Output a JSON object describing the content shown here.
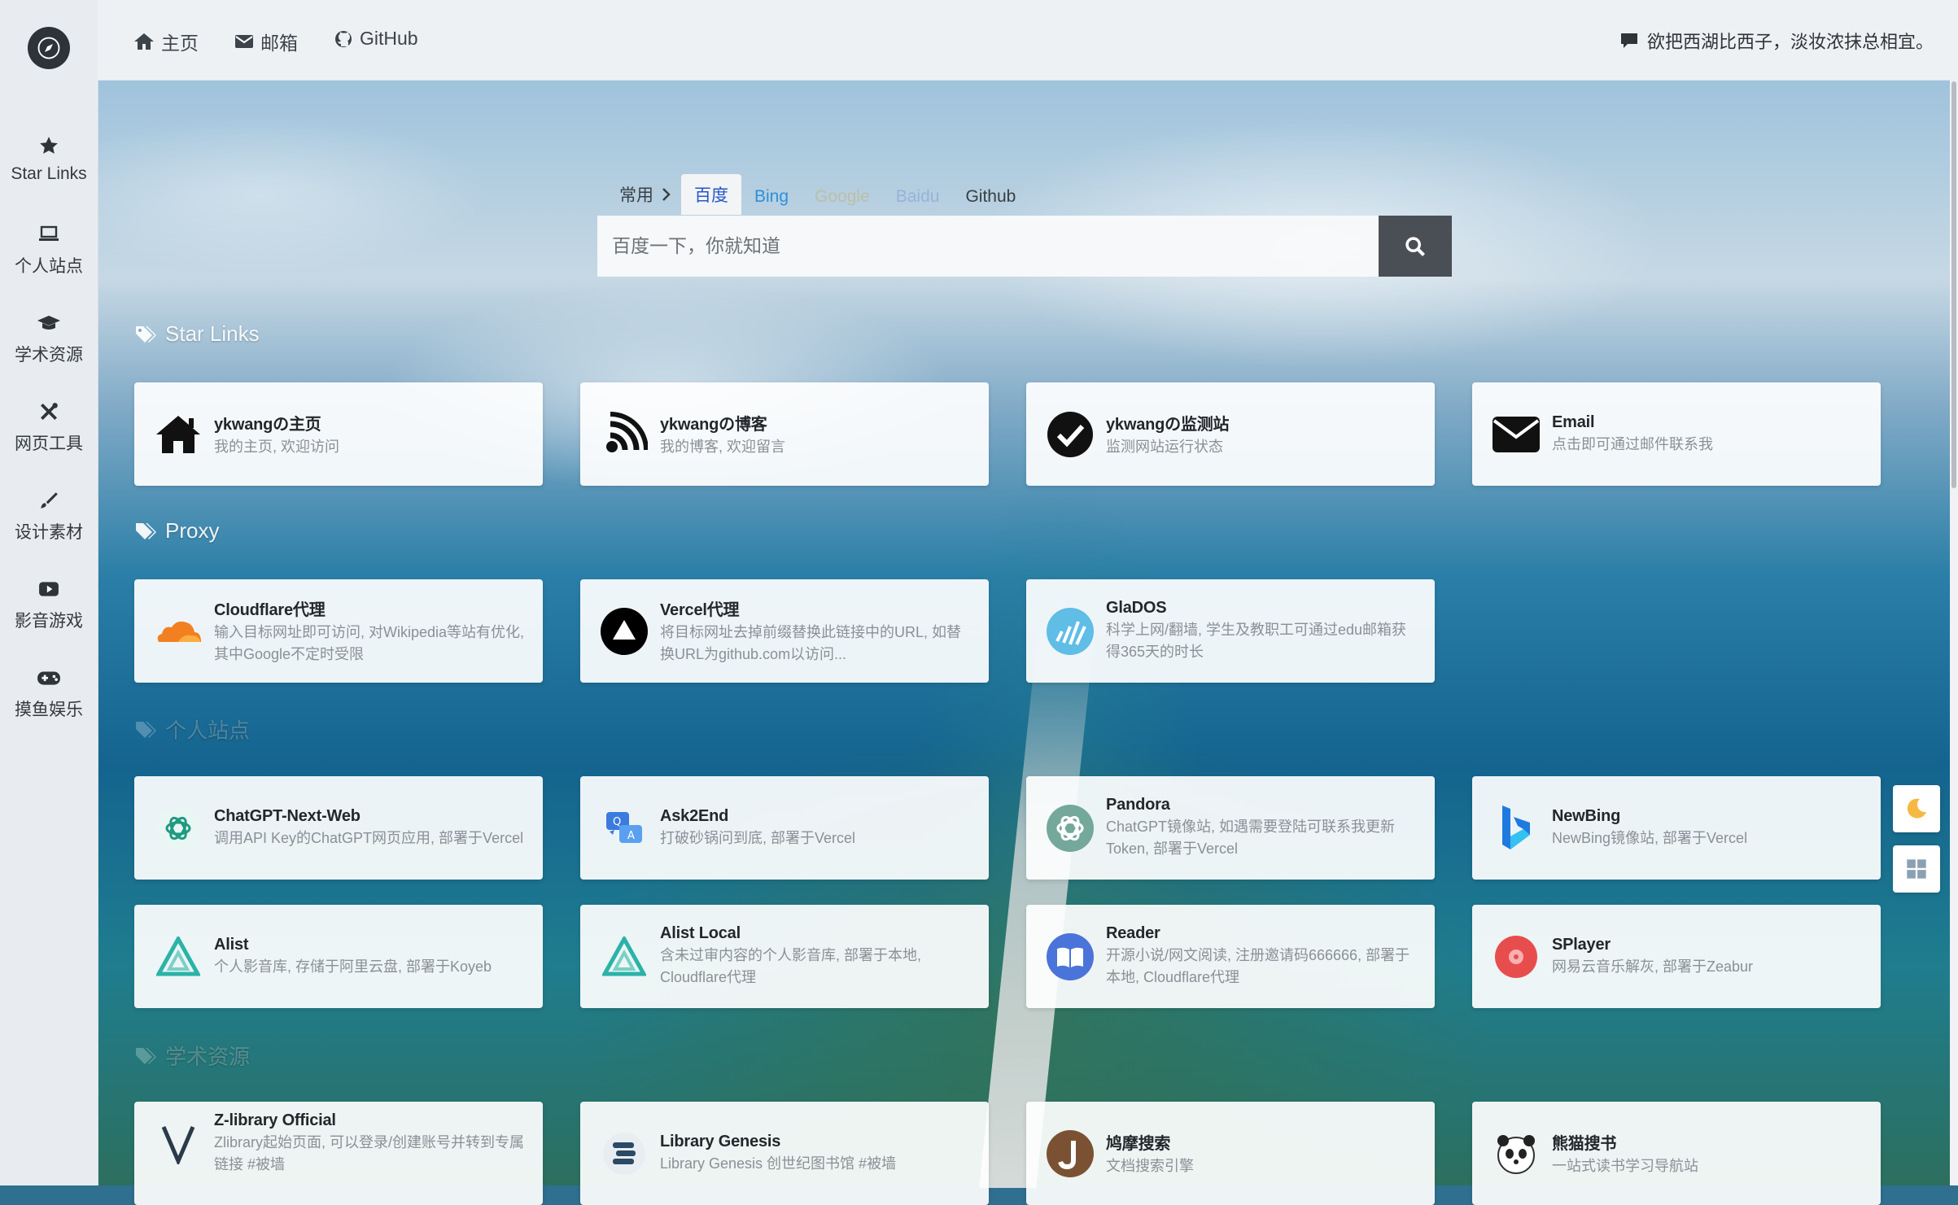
{
  "topbar": {
    "links": [
      {
        "label": "主页",
        "icon": "home-icon"
      },
      {
        "label": "邮箱",
        "icon": "mail-icon"
      },
      {
        "label": "GitHub",
        "icon": "github-icon"
      }
    ],
    "quote": "欲把西湖比西子，淡妆浓抹总相宜。"
  },
  "sidebar": {
    "items": [
      {
        "label": "Star Links",
        "icon": "star-icon"
      },
      {
        "label": "个人站点",
        "icon": "laptop-icon"
      },
      {
        "label": "学术资源",
        "icon": "graduation-cap-icon"
      },
      {
        "label": "网页工具",
        "icon": "tools-icon"
      },
      {
        "label": "设计素材",
        "icon": "brush-icon"
      },
      {
        "label": "影音游戏",
        "icon": "play-icon"
      },
      {
        "label": "摸鱼娱乐",
        "icon": "gamepad-icon"
      }
    ]
  },
  "search": {
    "group": "常用",
    "tabs": [
      "百度",
      "Bing",
      "Google",
      "Baidu",
      "Github"
    ],
    "active_tab": "百度",
    "placeholder": "百度一下，你就知道"
  },
  "sections": [
    {
      "title": "Star Links",
      "cards": [
        {
          "title": "ykwangの主页",
          "desc": "我的主页, 欢迎访问",
          "icon": "house-icon"
        },
        {
          "title": "ykwangの博客",
          "desc": "我的博客, 欢迎留言",
          "icon": "blog-feed-icon"
        },
        {
          "title": "ykwangの监测站",
          "desc": "监测网站运行状态",
          "icon": "check-circle-icon"
        },
        {
          "title": "Email",
          "desc": "点击即可通过邮件联系我",
          "icon": "envelope-icon"
        }
      ]
    },
    {
      "title": "Proxy",
      "cards": [
        {
          "title": "Cloudflare代理",
          "desc": "输入目标网址即可访问, 对Wikipedia等站有优化, 其中Google不定时受限",
          "icon": "cloudflare-icon"
        },
        {
          "title": "Vercel代理",
          "desc": "将目标网址去掉前缀替换此链接中的URL, 如替换URL为github.com以访问...",
          "icon": "vercel-icon"
        },
        {
          "title": "GlaDOS",
          "desc": "科学上网/翻墙, 学生及教职工可通过edu邮箱获得365天的时长",
          "icon": "glados-icon"
        }
      ]
    },
    {
      "title": "个人站点",
      "cards": [
        {
          "title": "ChatGPT-Next-Web",
          "desc": "调用API Key的ChatGPT网页应用, 部署于Vercel",
          "icon": "openai-icon"
        },
        {
          "title": "Ask2End",
          "desc": "打破砂锅问到底, 部署于Vercel",
          "icon": "ask2end-icon"
        },
        {
          "title": "Pandora",
          "desc": "ChatGPT镜像站, 如遇需要登陆可联系我更新Token, 部署于Vercel",
          "icon": "openai-green-icon"
        },
        {
          "title": "NewBing",
          "desc": "NewBing镜像站, 部署于Vercel",
          "icon": "bing-icon"
        },
        {
          "title": "Alist",
          "desc": "个人影音库, 存储于阿里云盘, 部署于Koyeb",
          "icon": "alist-icon"
        },
        {
          "title": "Alist Local",
          "desc": "含未过审内容的个人影音库, 部署于本地, Cloudflare代理",
          "icon": "alist-icon"
        },
        {
          "title": "Reader",
          "desc": "开源小说/网文阅读, 注册邀请码666666, 部署于本地, Cloudflare代理",
          "icon": "book-icon"
        },
        {
          "title": "SPlayer",
          "desc": "网易云音乐解灰, 部署于Zeabur",
          "icon": "splayer-icon"
        }
      ]
    },
    {
      "title": "学术资源",
      "cards": [
        {
          "title": "Z-library Official",
          "desc": "Zlibrary起始页面, 可以登录/创建账号并转到专属链接 #被墙",
          "icon": "zlibrary-icon"
        },
        {
          "title": "Library Genesis",
          "desc": "Library Genesis 创世纪图书馆 #被墙",
          "icon": "libgen-icon"
        },
        {
          "title": "鸠摩搜索",
          "desc": "文档搜索引擎",
          "icon": "jiumo-icon"
        },
        {
          "title": "熊猫搜书",
          "desc": "一站式读书学习导航站",
          "icon": "panda-icon"
        }
      ]
    }
  ]
}
